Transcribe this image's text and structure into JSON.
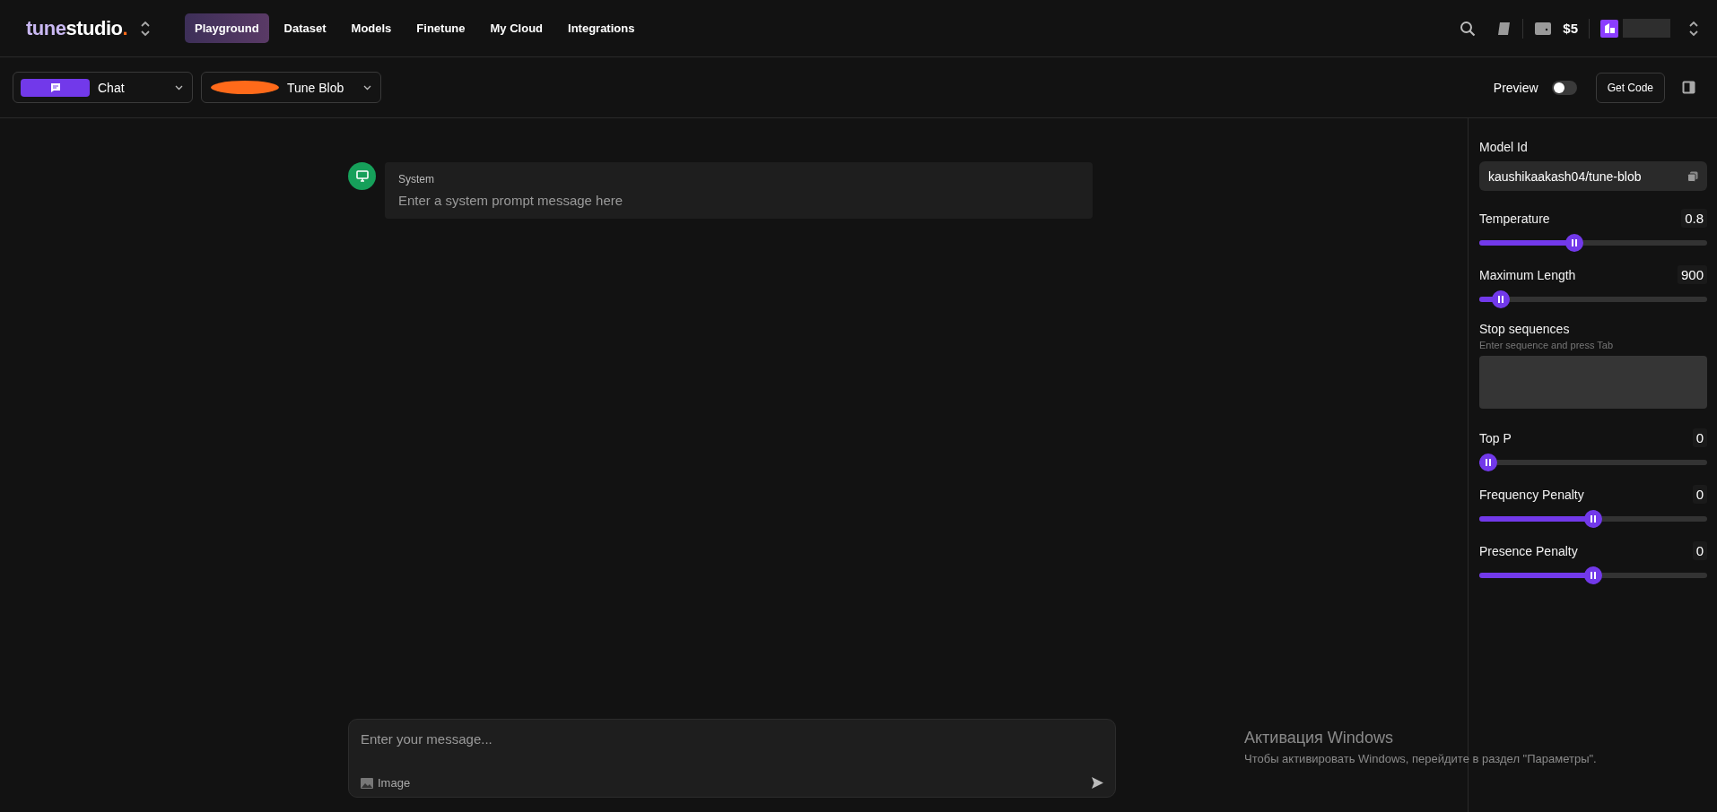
{
  "header": {
    "logo": {
      "parts": [
        {
          "text": "tune",
          "kind": "accent"
        },
        {
          "text": "studio",
          "kind": "plain"
        },
        {
          "text": ".",
          "kind": "dot"
        }
      ]
    },
    "nav": [
      {
        "label": "Playground",
        "selected": true
      },
      {
        "label": "Dataset",
        "selected": false
      },
      {
        "label": "Models",
        "selected": false
      },
      {
        "label": "Finetune",
        "selected": false
      },
      {
        "label": "My Cloud",
        "selected": false
      },
      {
        "label": "Integrations",
        "selected": false
      }
    ],
    "balance": "$5"
  },
  "toolbar": {
    "mode_select": {
      "value": "Chat"
    },
    "model_select": {
      "value": "Tune Blob"
    },
    "preview": {
      "label": "Preview",
      "on": false
    },
    "get_code": "Get Code"
  },
  "chat": {
    "system": {
      "role": "System",
      "placeholder": "Enter a system prompt message here"
    },
    "composer": {
      "placeholder": "Enter your message...",
      "attach_label": "Image"
    }
  },
  "params": {
    "model_id": {
      "label": "Model Id",
      "value": "kaushikaakash04/tune-blob"
    },
    "controls": [
      {
        "kind": "slider",
        "label": "Temperature",
        "reading": "0.8",
        "level": 0.41
      },
      {
        "kind": "slider",
        "label": "Maximum Length",
        "reading": "900",
        "level": 0.06
      },
      {
        "kind": "tags",
        "label": "Stop sequences",
        "hint": "Enter sequence and press Tab"
      },
      {
        "kind": "slider",
        "label": "Top P",
        "reading": "0",
        "level": 0
      },
      {
        "kind": "slider",
        "label": "Frequency Penalty",
        "reading": "0",
        "level": 0.5
      },
      {
        "kind": "slider",
        "label": "Presence Penalty",
        "reading": "0",
        "level": 0.5
      }
    ]
  },
  "os_notice": {
    "title": "Активация Windows",
    "text": "Чтобы активировать Windows, перейдите в раздел \"Параметры\"."
  }
}
